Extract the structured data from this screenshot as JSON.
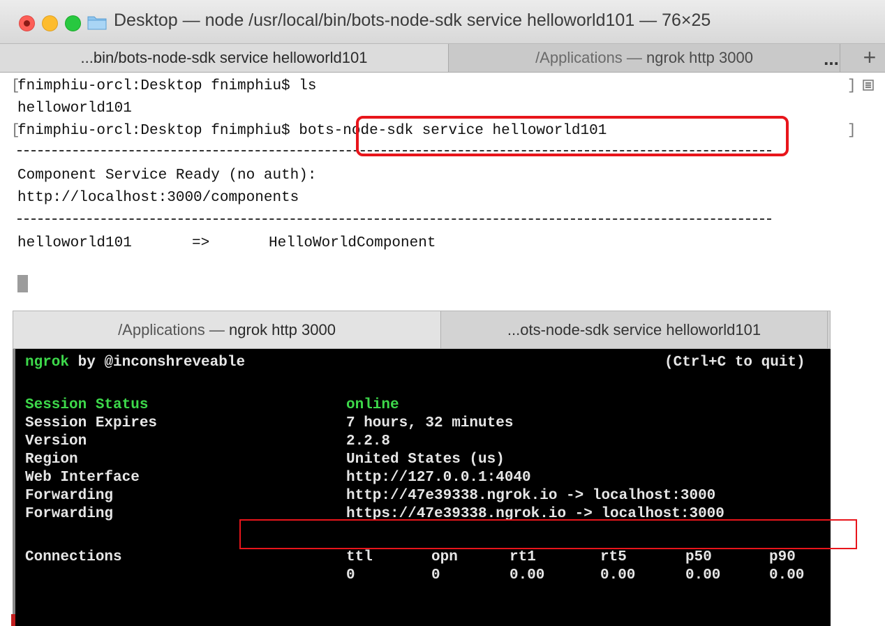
{
  "window": {
    "title": "Desktop — node /usr/local/bin/bots-node-sdk service helloworld101 — 76×25"
  },
  "top_tabs": {
    "tab1": "...bin/bots-node-sdk service helloworld101",
    "tab2_prefix": "/Applications — ",
    "tab2_suffix": "ngrok http 3000",
    "overflow": "...",
    "add": "+"
  },
  "top_terminal": {
    "line1": "fnimphiu-orcl:Desktop fnimphiu$ ls",
    "line2": "helloworld101",
    "line3_prompt": "fnimphiu-orcl:Desktop fnimphiu$ ",
    "line3_cmd": "bots-node-sdk service helloworld101",
    "line4": "Component Service Ready (no auth):",
    "line5": "http://localhost:3000/components",
    "line6_name": "helloworld101",
    "line6_arrow": "=>",
    "line6_component": "HelloWorldComponent",
    "bracket_left": "[",
    "bracket_right": "]"
  },
  "bottom_tabs": {
    "tab1_prefix": "/Applications — ",
    "tab1_suffix": "ngrok http 3000",
    "tab2": "...ots-node-sdk service helloworld101"
  },
  "ngrok": {
    "brand": "ngrok",
    "by": " by ",
    "author": "@inconshreveable",
    "quit_hint": "(Ctrl+C to quit)",
    "rows": [
      {
        "label": "Session Status",
        "value": "online"
      },
      {
        "label": "Session Expires",
        "value": "7 hours, 32 minutes"
      },
      {
        "label": "Version",
        "value": "2.2.8"
      },
      {
        "label": "Region",
        "value": "United States (us)"
      },
      {
        "label": "Web Interface",
        "value": "http://127.0.0.1:4040"
      },
      {
        "label": "Forwarding",
        "value": "http://47e39338.ngrok.io -> localhost:3000"
      },
      {
        "label": "Forwarding",
        "value": "https://47e39338.ngrok.io -> localhost:3000"
      }
    ],
    "connections": {
      "label": "Connections",
      "headers": [
        "ttl",
        "opn",
        "rt1",
        "rt5",
        "p50",
        "p90"
      ],
      "values": [
        "0",
        "0",
        "0.00",
        "0.00",
        "0.00",
        "0.00"
      ]
    }
  },
  "colors": {
    "highlight": "#e8151b",
    "ngrok_green": "#3dd84a"
  }
}
